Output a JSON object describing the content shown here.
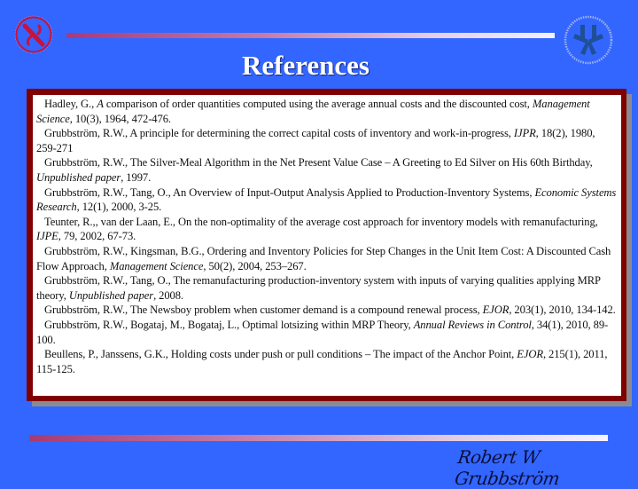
{
  "slide": {
    "title": "References",
    "signature": "Robert W Grubbström",
    "colors": {
      "background": "#3366ff",
      "box_border": "#800000",
      "box_shadow": "#8a8a92",
      "title": "#ffffff",
      "left_logo": "#c8123c",
      "right_logo": "#1f4f96"
    },
    "logos": {
      "left": "aleph-seal-icon",
      "right": "university-seal-icon"
    }
  },
  "references": [
    {
      "pre": "Hadley, G., ",
      "italic": "A",
      "post": " comparison of order quantities computed using the average annual costs and the discounted cost, ",
      "italic2": "Management Science",
      "post2": ", 10(3), 1964, 472-476."
    },
    {
      "pre": "Grubbström, R.W., A principle for determining the correct capital costs of inventory and work-in-progress, ",
      "italic": "IJPR",
      "post": ", 18(2), 1980, 259-271",
      "italic2": "",
      "post2": ""
    },
    {
      "pre": "Grubbström, R.W., The Silver-Meal Algorithm in the Net Present Value Case – A Greeting to Ed Silver on His 60th Birthday, ",
      "italic": "Unpublished paper",
      "post": ", 1997.",
      "italic2": "",
      "post2": ""
    },
    {
      "pre": "Grubbström, R.W., Tang, O., An Overview of Input-Output Analysis Applied to Production-Inventory Systems, ",
      "italic": "Economic Systems Research",
      "post": ", 12(1), 2000, 3-25.",
      "italic2": "",
      "post2": ""
    },
    {
      "pre": "Teunter, R.,, van der Laan, E., On the non-optimality of the average cost approach for inventory models with remanufacturing, ",
      "italic": "IJPE",
      "post": ", 79, 2002, 67-73.",
      "italic2": "",
      "post2": ""
    },
    {
      "pre": "Grubbström, R.W., Kingsman, B.G., Ordering and Inventory Policies for Step Changes in the Unit Item Cost: A Discounted Cash Flow Approach, ",
      "italic": "Management Science",
      "post": ", 50(2), 2004, 253–267.",
      "italic2": "",
      "post2": ""
    },
    {
      "pre": "Grubbström, R.W., Tang, O., The remanufacturing production-inventory system with inputs of varying qualities applying MRP theory, ",
      "italic": "Unpublished paper",
      "post": ", 2008.",
      "italic2": "",
      "post2": ""
    },
    {
      "pre": "Grubbström, R.W., The Newsboy problem when customer demand is a compound renewal process, ",
      "italic": "EJOR",
      "post": ", 203(1), 2010, 134-142.",
      "italic2": "",
      "post2": ""
    },
    {
      "pre": "Grubbström, R.W., Bogataj, M., Bogataj, L., Optimal lotsizing within MRP Theory, ",
      "italic": "Annual Reviews in Control",
      "post": ", 34(1), 2010, 89-100.",
      "italic2": "",
      "post2": ""
    },
    {
      "pre": "Beullens, P., Janssens, G.K., Holding costs under push or pull conditions – The impact of the Anchor Point, ",
      "italic": "EJOR",
      "post": ", 215(1), 2011, 115-125.",
      "italic2": "",
      "post2": ""
    }
  ]
}
